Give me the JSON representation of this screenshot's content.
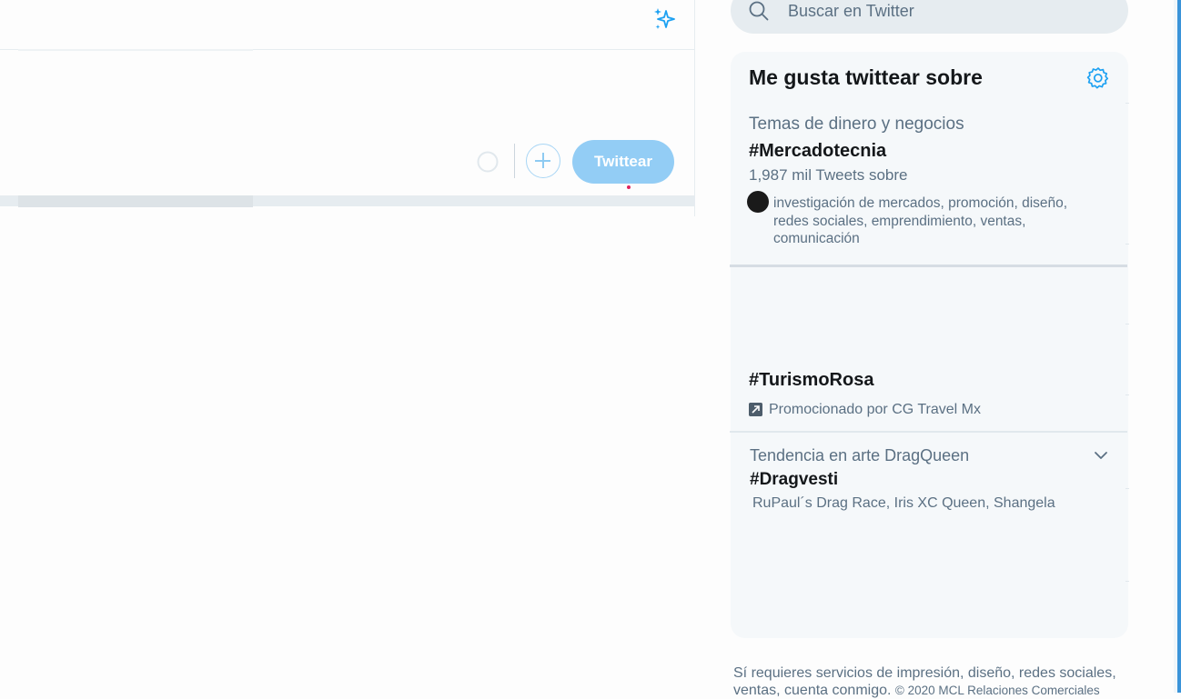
{
  "composer": {
    "tweet_button_label": "Twittear"
  },
  "search": {
    "placeholder": "Buscar en Twitter"
  },
  "trends": {
    "title": "Me gusta twittear sobre",
    "items": [
      {
        "label": "Temas de dinero y negocios",
        "hashtag": "#Mercadotecnia",
        "count": "1,987 mil Tweets sobre",
        "related_line1": "investigación de mercados, promoción, diseño,",
        "related_line2": "redes sociales, emprendimiento, ventas,",
        "related_line3": "comunicación"
      },
      {
        "hashtag": "#TurismoRosa",
        "promoted": "Promocionado por CG Travel Mx"
      },
      {
        "label": "Tendencia en arte DragQueen",
        "hashtag": "#Dragvesti",
        "related": "RuPaul´s Drag Race, Iris XC Queen, Shangela"
      }
    ]
  },
  "footer": {
    "line1": "Sí requieres servicios de impresión, diseño, redes sociales,",
    "line2_main": "ventas, cuenta conmigo.",
    "line2_small": "© 2020 MCL Relaciones Comerciales"
  },
  "colors": {
    "accent": "#1da1f2",
    "tweet_button_disabled": "#93cdf5",
    "panel_background": "#f5f8fa",
    "secondary_text": "#5b7083"
  },
  "icons": [
    "sparkle-icon",
    "search-icon",
    "settings-icon",
    "plus-icon",
    "promoted-icon",
    "chevron-down-icon"
  ]
}
